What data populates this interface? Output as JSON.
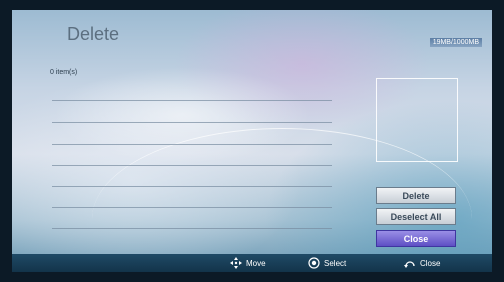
{
  "header": {
    "title": "Delete",
    "storage": "19MB/1000MB"
  },
  "list": {
    "count_label": "0 item(s)"
  },
  "buttons": [
    {
      "label": "Delete"
    },
    {
      "label": "Deselect All"
    },
    {
      "label": "Close",
      "selected": true
    }
  ],
  "footer": {
    "move_label": "Move",
    "select_label": "Select",
    "close_label": "Close"
  },
  "colors": {
    "selected_button": "#5e4fc4",
    "footer_bar": "#13344a"
  },
  "icons": [
    "dpad-icon",
    "select-circle-icon",
    "return-icon"
  ]
}
